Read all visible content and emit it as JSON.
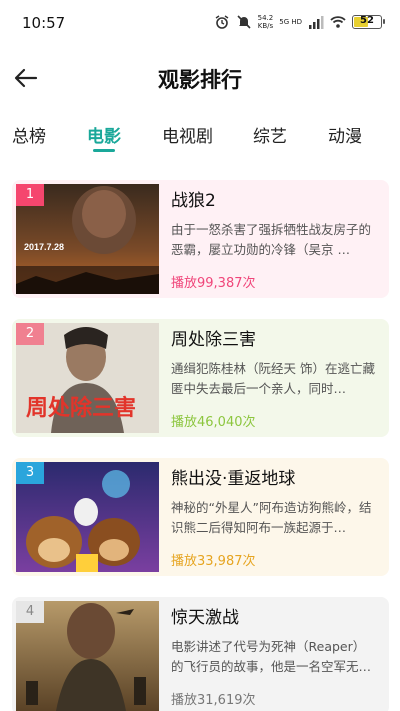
{
  "status_bar": {
    "time": "10:57",
    "net_speed": "54.2",
    "net_unit": "KB/s",
    "net_type": "5G HD",
    "battery": "52",
    "icons": [
      "alarm-icon",
      "mute-icon",
      "wifi-icon",
      "signal-icon"
    ]
  },
  "header": {
    "title": "观影排行",
    "back_icon": "arrow-left-icon"
  },
  "tabs": [
    {
      "label": "总榜",
      "active": false
    },
    {
      "label": "电影",
      "active": true
    },
    {
      "label": "电视剧",
      "active": false
    },
    {
      "label": "综艺",
      "active": false
    },
    {
      "label": "动漫",
      "active": false
    }
  ],
  "movies": [
    {
      "rank": "1",
      "title": "战狼2",
      "description": "由于一怒杀害了强拆牺牲战友房子的恶霸，屡立功勋的冷锋（吴京 …",
      "plays": "播放99,387次",
      "poster_text": "2017.7.28",
      "card_bg": "#fff1f5",
      "rank_color": "#f5466e",
      "plays_color": "#f0467a"
    },
    {
      "rank": "2",
      "title": "周处除三害",
      "description": "通缉犯陈桂林（阮经天 饰）在逃亡藏匿中失去最后一个亲人，同时…",
      "plays": "播放46,040次",
      "poster_text": "周处除三害",
      "card_bg": "#f3f8ea",
      "rank_color": "#f08090",
      "plays_color": "#8cc63e"
    },
    {
      "rank": "3",
      "title": "熊出没·重返地球",
      "description": "神秘的“外星人”阿布造访狗熊岭，结识熊二后得知阿布一族起源于…",
      "plays": "播放33,987次",
      "poster_text": "",
      "card_bg": "#fdf7ea",
      "rank_color": "#2aa5dc",
      "plays_color": "#e6a521"
    },
    {
      "rank": "4",
      "title": "惊天激战",
      "description": "电影讲述了代号为死神（Reaper）的飞行员的故事，他是一名空军无…",
      "plays": "播放31,619次",
      "poster_text": "",
      "card_bg": "#f3f3f3",
      "rank_color": "#e6e6e6",
      "plays_color": "#777777"
    }
  ],
  "accent_color": "#1aa89a"
}
